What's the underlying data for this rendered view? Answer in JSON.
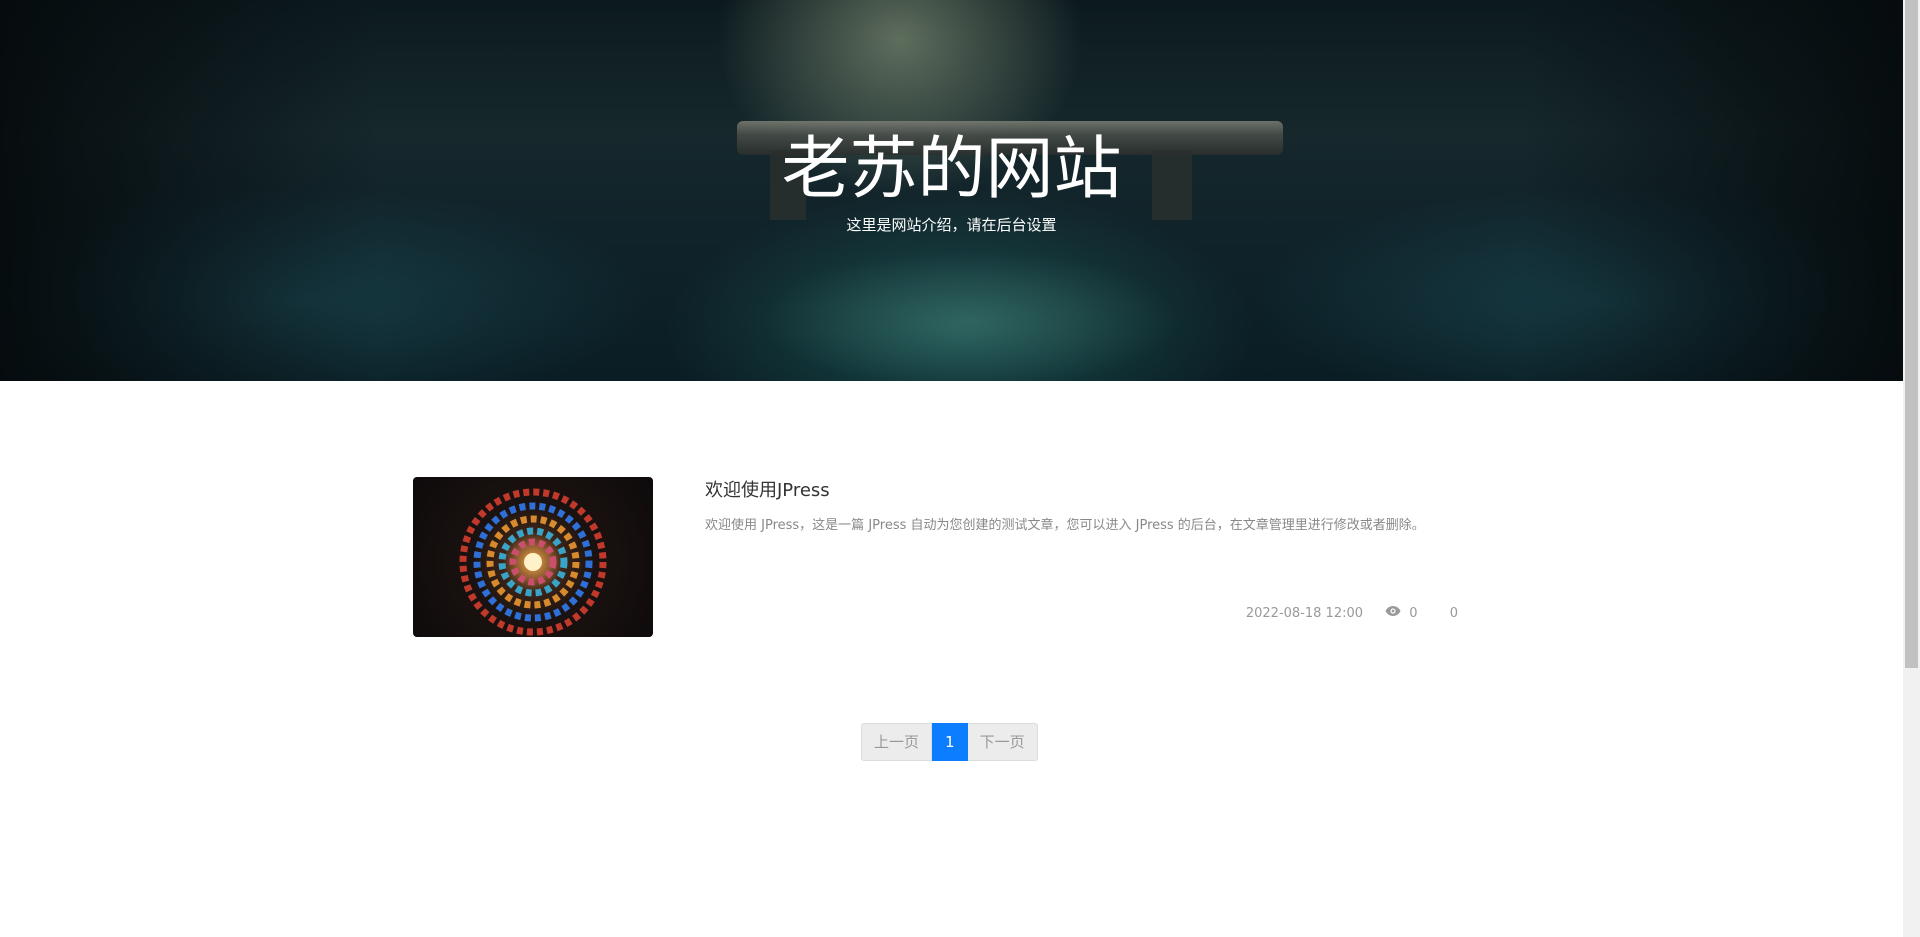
{
  "hero": {
    "title": "老苏的网站",
    "subtitle": "这里是网站介绍，请在后台设置"
  },
  "articles": [
    {
      "title": "欢迎使用JPress",
      "summary": "欢迎使用 JPress，这是一篇 JPress 自动为您创建的测试文章，您可以进入 JPress 的后台，在文章管理里进行修改或者删除。",
      "date": "2022-08-18 12:00",
      "views": "0",
      "comments": "0",
      "thumbnail_icon": "spiral-stained-glass-image"
    }
  ],
  "pagination": {
    "prev_label": "上一页",
    "current_page": "1",
    "next_label": "下一页"
  },
  "colors": {
    "accent": "#0d7dff",
    "hero_text": "#ffffff",
    "meta_text": "#999999"
  }
}
